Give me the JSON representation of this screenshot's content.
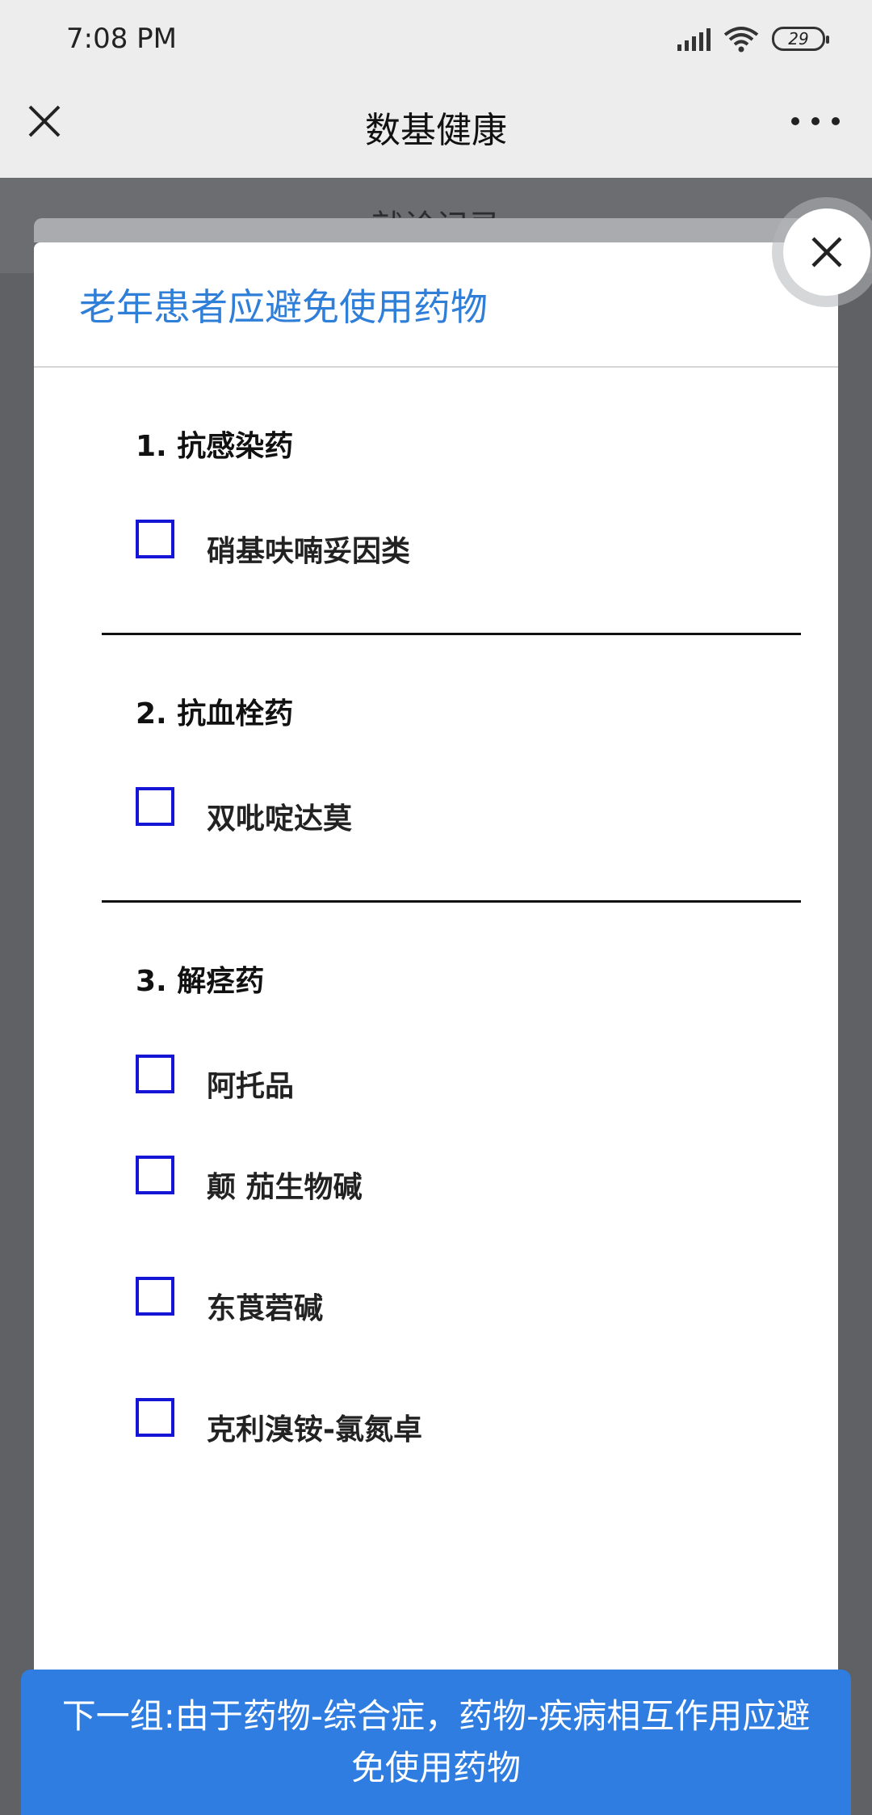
{
  "status_bar": {
    "time": "7:08 PM",
    "battery": "29"
  },
  "nav": {
    "title": "数基健康"
  },
  "background_page": {
    "title": "就诊记录"
  },
  "modal": {
    "title": "老年患者应避免使用药物",
    "groups": [
      {
        "title": "1. 抗感染药",
        "items": [
          {
            "label": "硝基呋喃妥因类",
            "checked": false
          }
        ]
      },
      {
        "title": "2. 抗血栓药",
        "items": [
          {
            "label": "双吡啶达莫",
            "checked": false
          }
        ]
      },
      {
        "title": "3. 解痉药",
        "items": [
          {
            "label": "阿托品",
            "checked": false
          },
          {
            "label": "颠 茄生物碱",
            "checked": false
          },
          {
            "label": "东莨菪碱",
            "checked": false
          },
          {
            "label": "克利溴铵-氯氮卓",
            "checked": false
          }
        ]
      }
    ]
  },
  "next_button": {
    "label": "下一组:由于药物-综合症，药物-疾病相互作用应避免使用药物"
  },
  "colors": {
    "accent": "#2f7fd9",
    "button": "#2f7de0",
    "checkbox": "#1515d6"
  }
}
